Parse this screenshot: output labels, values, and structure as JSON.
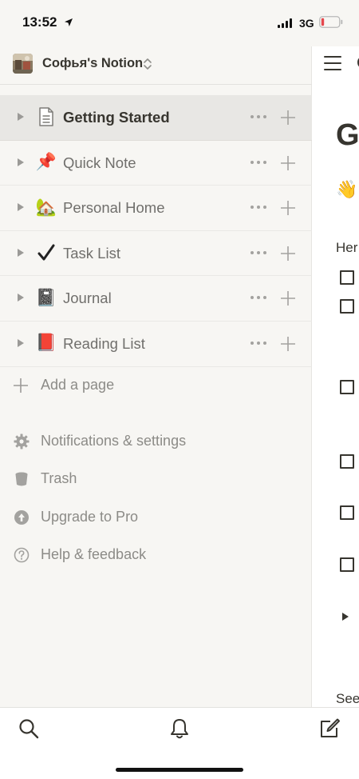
{
  "status_bar": {
    "time": "13:52",
    "network": "3G"
  },
  "workspace": {
    "name": "Софья's Notion"
  },
  "pages": [
    {
      "title": "Getting Started",
      "icon": "page-icon",
      "active": true
    },
    {
      "title": "Quick Note",
      "icon": "📌",
      "active": false
    },
    {
      "title": "Personal Home",
      "icon": "🏡",
      "active": false
    },
    {
      "title": "Task List",
      "icon": "✔️",
      "active": false
    },
    {
      "title": "Journal",
      "icon": "📓",
      "active": false
    },
    {
      "title": "Reading List",
      "icon": "📕",
      "active": false
    }
  ],
  "add_page_label": "Add a page",
  "menu": [
    {
      "label": "Notifications & settings",
      "icon": "gear-icon"
    },
    {
      "label": "Trash",
      "icon": "trash-icon"
    },
    {
      "label": "Upgrade to Pro",
      "icon": "upgrade-icon"
    },
    {
      "label": "Help & feedback",
      "icon": "help-icon"
    }
  ],
  "content": {
    "title_fragment": "G",
    "wave": "👋",
    "intro_fragment": "Her",
    "see_fragment": "See",
    "topbar_fragment": "G"
  },
  "colors": {
    "sidebar_bg": "#f7f6f3",
    "active_row_bg": "#e8e7e4",
    "text_primary": "#37352f",
    "text_secondary": "#706f6c",
    "battery_low": "#e5484d"
  }
}
